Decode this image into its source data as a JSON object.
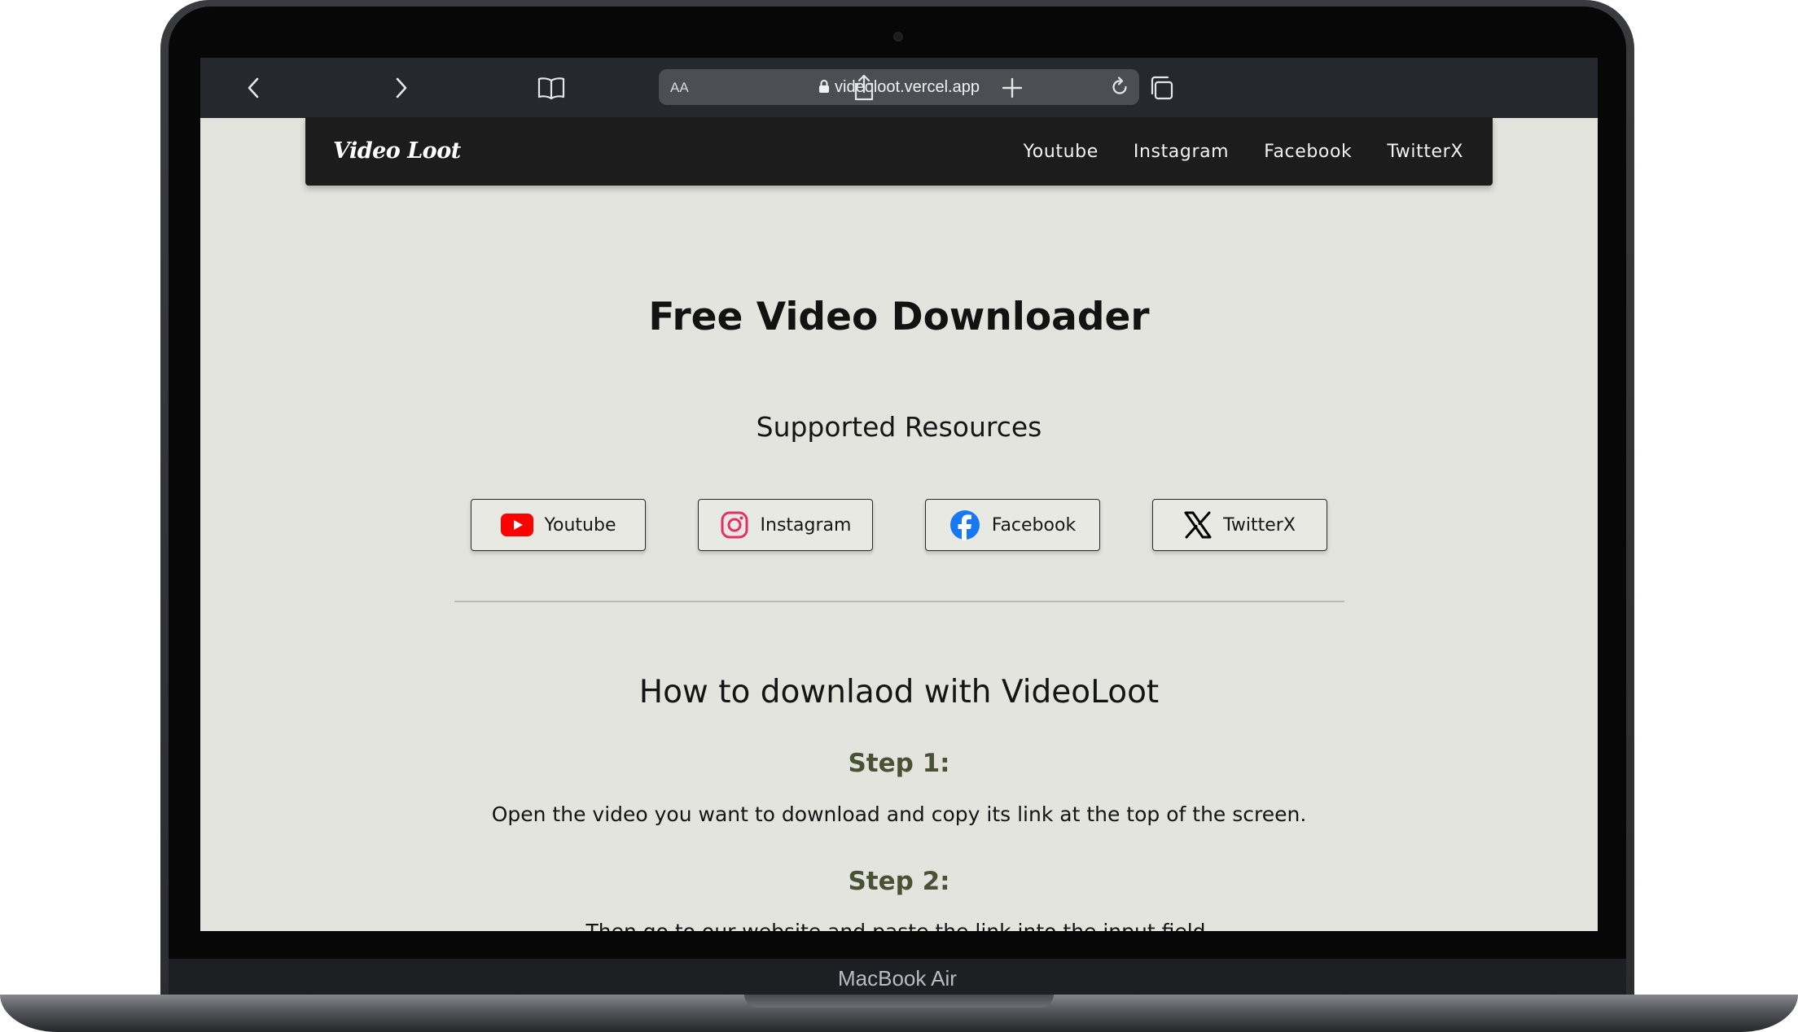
{
  "device": {
    "label": "MacBook Air"
  },
  "browser": {
    "text_size_label": "AA",
    "url": "videoloot.vercel.app",
    "icons": [
      "back-icon",
      "forward-icon",
      "bookmarks-icon",
      "lock-icon",
      "reload-icon",
      "share-icon",
      "new-tab-icon",
      "tabs-icon"
    ]
  },
  "site": {
    "logo": "Video Loot",
    "nav": [
      "Youtube",
      "Instagram",
      "Facebook",
      "TwitterX"
    ]
  },
  "main": {
    "title": "Free Video Downloader",
    "resources_heading": "Supported Resources",
    "resources": [
      {
        "label": "Youtube",
        "icon": "youtube-icon",
        "color": "#ff0000"
      },
      {
        "label": "Instagram",
        "icon": "instagram-icon",
        "color": "#e1306c"
      },
      {
        "label": "Facebook",
        "icon": "facebook-icon",
        "color": "#1877f2"
      },
      {
        "label": "TwitterX",
        "icon": "x-icon",
        "color": "#000000"
      }
    ],
    "howto_heading": "How to downlaod with VideoLoot",
    "steps": [
      {
        "title": "Step 1:",
        "text": "Open the video you want to download and copy its link at the top of the screen."
      },
      {
        "title": "Step 2:",
        "text": "Then go to our website and paste the link into the input field."
      }
    ]
  },
  "colors": {
    "page_bg": "#e4e4df",
    "nav_bg": "#1c1c1c",
    "toolbar_bg": "#25282c",
    "step_heading": "#4a5236"
  }
}
